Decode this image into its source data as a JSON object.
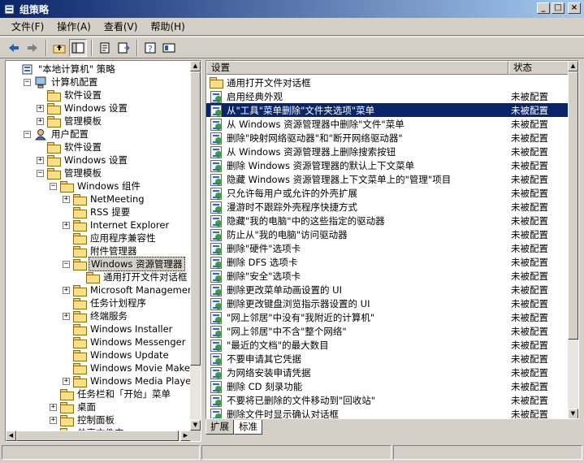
{
  "window": {
    "title": "组策略"
  },
  "window_buttons": {
    "minimize": "_",
    "maximize": "□",
    "close": "×"
  },
  "menu": [
    {
      "label": "文件(F)"
    },
    {
      "label": "操作(A)"
    },
    {
      "label": "查看(V)"
    },
    {
      "label": "帮助(H)"
    }
  ],
  "toolbar": [
    "back-icon",
    "forward-icon",
    "up-icon",
    "show-tree-icon",
    "properties-icon",
    "export-icon",
    "help-icon",
    "console-icon"
  ],
  "tree": {
    "nodes": [
      {
        "label": "\"本地计算机\" 策略",
        "level": 0,
        "expander": "",
        "icon": "policy-root"
      },
      {
        "label": "计算机配置",
        "level": 1,
        "expander": "−",
        "icon": "computer"
      },
      {
        "label": "软件设置",
        "level": 2,
        "expander": "",
        "icon": "folder"
      },
      {
        "label": "Windows 设置",
        "level": 2,
        "expander": "+",
        "icon": "folder"
      },
      {
        "label": "管理模板",
        "level": 2,
        "expander": "+",
        "icon": "folder"
      },
      {
        "label": "用户配置",
        "level": 1,
        "expander": "−",
        "icon": "user"
      },
      {
        "label": "软件设置",
        "level": 2,
        "expander": "",
        "icon": "folder"
      },
      {
        "label": "Windows 设置",
        "level": 2,
        "expander": "+",
        "icon": "folder"
      },
      {
        "label": "管理模板",
        "level": 2,
        "expander": "−",
        "icon": "folder"
      },
      {
        "label": "Windows 组件",
        "level": 3,
        "expander": "−",
        "icon": "folder"
      },
      {
        "label": "NetMeeting",
        "level": 4,
        "expander": "+",
        "icon": "folder"
      },
      {
        "label": "RSS 提要",
        "level": 4,
        "expander": "",
        "icon": "folder"
      },
      {
        "label": "Internet Explorer",
        "level": 4,
        "expander": "+",
        "icon": "folder"
      },
      {
        "label": "应用程序兼容性",
        "level": 4,
        "expander": "",
        "icon": "folder"
      },
      {
        "label": "附件管理器",
        "level": 4,
        "expander": "",
        "icon": "folder"
      },
      {
        "label": "Windows 资源管理器",
        "level": 4,
        "expander": "−",
        "icon": "folder",
        "selected": true
      },
      {
        "label": "通用打开文件对话框",
        "level": 5,
        "expander": "",
        "icon": "folder"
      },
      {
        "label": "Microsoft Management",
        "level": 4,
        "expander": "+",
        "icon": "folder"
      },
      {
        "label": "任务计划程序",
        "level": 4,
        "expander": "",
        "icon": "folder"
      },
      {
        "label": "终端服务",
        "level": 4,
        "expander": "+",
        "icon": "folder"
      },
      {
        "label": "Windows Installer",
        "level": 4,
        "expander": "",
        "icon": "folder"
      },
      {
        "label": "Windows Messenger",
        "level": 4,
        "expander": "",
        "icon": "folder"
      },
      {
        "label": "Windows Update",
        "level": 4,
        "expander": "",
        "icon": "folder"
      },
      {
        "label": "Windows Movie Maker",
        "level": 4,
        "expander": "",
        "icon": "folder"
      },
      {
        "label": "Windows Media Player",
        "level": 4,
        "expander": "+",
        "icon": "folder"
      },
      {
        "label": "任务栏和「开始」菜单",
        "level": 3,
        "expander": "",
        "icon": "folder"
      },
      {
        "label": "桌面",
        "level": 3,
        "expander": "+",
        "icon": "folder"
      },
      {
        "label": "控制面板",
        "level": 3,
        "expander": "+",
        "icon": "folder"
      },
      {
        "label": "共享文件夹",
        "level": 3,
        "expander": "",
        "icon": "folder"
      }
    ]
  },
  "list": {
    "columns": {
      "setting": "设置",
      "state": "状态"
    },
    "rows": [
      {
        "name": "通用打开文件对话框",
        "state": "",
        "icon": "folder"
      },
      {
        "name": "启用经典外观",
        "state": "未被配置",
        "icon": "policy"
      },
      {
        "name": "从\"工具\"菜单删除\"文件夹选项\"菜单",
        "state": "未被配置",
        "icon": "policy",
        "selected": true
      },
      {
        "name": "从 Windows 资源管理器中删除\"文件\"菜单",
        "state": "未被配置",
        "icon": "policy"
      },
      {
        "name": "删除\"映射网络驱动器\"和\"断开网络驱动器\"",
        "state": "未被配置",
        "icon": "policy"
      },
      {
        "name": "从 Windows 资源管理器上删除搜索按钮",
        "state": "未被配置",
        "icon": "policy"
      },
      {
        "name": "删除 Windows 资源管理器的默认上下文菜单",
        "state": "未被配置",
        "icon": "policy"
      },
      {
        "name": "隐藏 Windows 资源管理器上下文菜单上的\"管理\"项目",
        "state": "未被配置",
        "icon": "policy"
      },
      {
        "name": "只允许每用户或允许的外壳扩展",
        "state": "未被配置",
        "icon": "policy"
      },
      {
        "name": "漫游时不跟踪外壳程序快捷方式",
        "state": "未被配置",
        "icon": "policy"
      },
      {
        "name": "隐藏\"我的电脑\"中的这些指定的驱动器",
        "state": "未被配置",
        "icon": "policy"
      },
      {
        "name": "防止从\"我的电脑\"访问驱动器",
        "state": "未被配置",
        "icon": "policy"
      },
      {
        "name": "删除\"硬件\"选项卡",
        "state": "未被配置",
        "icon": "policy"
      },
      {
        "name": "删除 DFS 选项卡",
        "state": "未被配置",
        "icon": "policy"
      },
      {
        "name": "删除\"安全\"选项卡",
        "state": "未被配置",
        "icon": "policy"
      },
      {
        "name": "删除更改菜单动画设置的 UI",
        "state": "未被配置",
        "icon": "policy"
      },
      {
        "name": "删除更改键盘浏览指示器设置的 UI",
        "state": "未被配置",
        "icon": "policy"
      },
      {
        "name": "\"网上邻居\"中没有\"我附近的计算机\"",
        "state": "未被配置",
        "icon": "policy"
      },
      {
        "name": "\"网上邻居\"中不含\"整个网络\"",
        "state": "未被配置",
        "icon": "policy"
      },
      {
        "name": "\"最近的文档\"的最大数目",
        "state": "未被配置",
        "icon": "policy"
      },
      {
        "name": "不要申请其它凭据",
        "state": "未被配置",
        "icon": "policy"
      },
      {
        "name": "为网络安装申请凭据",
        "state": "未被配置",
        "icon": "policy"
      },
      {
        "name": "删除 CD 刻录功能",
        "state": "未被配置",
        "icon": "policy"
      },
      {
        "name": "不要将已删除的文件移动到\"回收站\"",
        "state": "未被配置",
        "icon": "policy"
      },
      {
        "name": "删除文件时显示确认对话框",
        "state": "未被配置",
        "icon": "policy"
      }
    ]
  },
  "tabs": [
    {
      "label": "扩展"
    },
    {
      "label": "标准",
      "active": true
    }
  ]
}
